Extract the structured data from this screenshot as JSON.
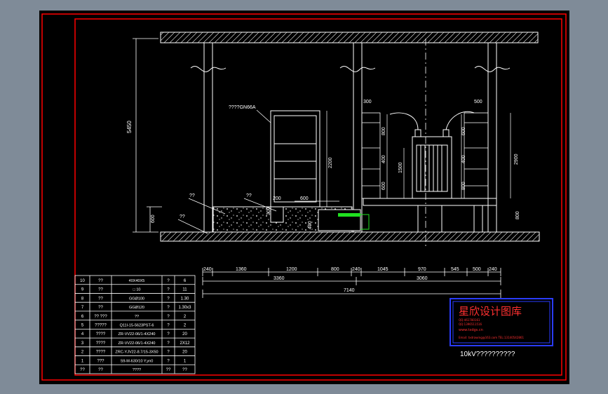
{
  "colors": {
    "background": "#7f8b98",
    "sheet": "#000000",
    "border": "#ff0000",
    "lines": "#ffffff",
    "stamp_border": "#2a3cff",
    "stamp_text": "#ff3030",
    "highlight": "#20e020"
  },
  "drawing": {
    "height_5450": "5450",
    "height_600": "600",
    "height_2200": "2200",
    "height_800a": "800",
    "height_400a": "400",
    "height_1500": "1500",
    "height_600b": "600",
    "height_2900": "2900",
    "height_800b": "800",
    "height_600c": "600",
    "height_400b": "400",
    "height_800c": "800",
    "height_300": "300",
    "width_200": "200",
    "width_600": "600",
    "width_300": "300",
    "width_500": "500",
    "cabinet_label": "????GN66A",
    "label_q1": "??",
    "label_q2": "??",
    "label_q3": "??"
  },
  "dimensions": {
    "row1": [
      "240",
      "1360",
      "1200",
      "800",
      "240",
      "1045",
      "970",
      "545",
      "500",
      "240"
    ],
    "row2": [
      "3360",
      "3060"
    ],
    "total": "7140"
  },
  "bom_table": {
    "rows": [
      [
        "10",
        "??",
        "40X40X5",
        "?",
        "6"
      ],
      [
        "9",
        "??",
        "□ 10",
        "?",
        "11"
      ],
      [
        "8",
        "??",
        "GGØ100",
        "?",
        "1.30"
      ],
      [
        "7",
        "??",
        "GGØ120",
        "?",
        "1.30x3"
      ],
      [
        "6",
        "?? ???",
        "??",
        "?",
        "2"
      ],
      [
        "5",
        "?????",
        "Q11I-15-5623PST-6",
        "?",
        "2"
      ],
      [
        "4",
        "????",
        "ZR-VV22-06/1-4X240",
        "?",
        "20"
      ],
      [
        "3",
        "????",
        "ZR-VV22-06/1-4X240",
        "?",
        "2X12"
      ],
      [
        "2",
        "????",
        "ZRC-YJV22-8.7/15-3X50",
        "?",
        "20"
      ],
      [
        "1",
        "???",
        "S9-M-630/10 Y,yn0",
        "?",
        "1"
      ],
      [
        "??",
        "??",
        "????",
        "??",
        "??"
      ]
    ]
  },
  "stamp": {
    "title": "星欣设计图库",
    "line1": "QQ:461780161",
    "line2": "QQ:1396511516",
    "line3": "www.txdgs.cn",
    "line4": "Email: txdrawing@163.com  TEL:13140542861"
  },
  "drawing_title": "10kV??????????"
}
